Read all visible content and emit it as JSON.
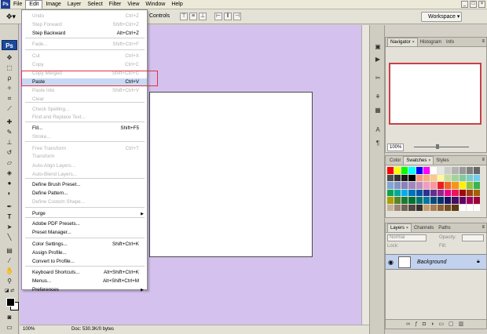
{
  "menubar": {
    "items": [
      "File",
      "Edit",
      "Image",
      "Layer",
      "Select",
      "Filter",
      "View",
      "Window",
      "Help"
    ],
    "active_index": 1
  },
  "options_bar": {
    "controls_label": "Controls",
    "workspace_label": "Workspace ▾"
  },
  "tools": {
    "ps_logo": "Ps"
  },
  "edit_menu": {
    "items": [
      {
        "label": "Undo",
        "shortcut": "Ctrl+Z",
        "enabled": false
      },
      {
        "label": "Step Forward",
        "shortcut": "Shift+Ctrl+Z",
        "enabled": false
      },
      {
        "label": "Step Backward",
        "shortcut": "Alt+Ctrl+Z",
        "enabled": true
      },
      {
        "label": "Fade...",
        "shortcut": "Shift+Ctrl+F",
        "enabled": false
      },
      {
        "label": "Cut",
        "shortcut": "Ctrl+X",
        "enabled": false
      },
      {
        "label": "Copy",
        "shortcut": "Ctrl+C",
        "enabled": false
      },
      {
        "label": "Copy Merged",
        "shortcut": "Shift+Ctrl+C",
        "enabled": false
      },
      {
        "label": "Paste",
        "shortcut": "Ctrl+V",
        "enabled": true,
        "highlighted": true
      },
      {
        "label": "Paste Into",
        "shortcut": "Shift+Ctrl+V",
        "enabled": false
      },
      {
        "label": "Clear",
        "shortcut": "",
        "enabled": false
      },
      {
        "label": "Check Spelling...",
        "shortcut": "",
        "enabled": false
      },
      {
        "label": "Find and Replace Text...",
        "shortcut": "",
        "enabled": false
      },
      {
        "label": "Fill...",
        "shortcut": "Shift+F5",
        "enabled": true
      },
      {
        "label": "Stroke...",
        "shortcut": "",
        "enabled": false
      },
      {
        "label": "Free Transform",
        "shortcut": "Ctrl+T",
        "enabled": false
      },
      {
        "label": "Transform",
        "shortcut": "",
        "enabled": false
      },
      {
        "label": "Auto-Align Layers...",
        "shortcut": "",
        "enabled": false
      },
      {
        "label": "Auto-Blend Layers...",
        "shortcut": "",
        "enabled": false
      },
      {
        "label": "Define Brush Preset...",
        "shortcut": "",
        "enabled": true
      },
      {
        "label": "Define Pattern...",
        "shortcut": "",
        "enabled": true
      },
      {
        "label": "Define Custom Shape...",
        "shortcut": "",
        "enabled": false
      },
      {
        "label": "Purge",
        "shortcut": "",
        "enabled": true,
        "submenu": true
      },
      {
        "label": "Adobe PDF Presets...",
        "shortcut": "",
        "enabled": true
      },
      {
        "label": "Preset Manager...",
        "shortcut": "",
        "enabled": true
      },
      {
        "label": "Color Settings...",
        "shortcut": "Shift+Ctrl+K",
        "enabled": true
      },
      {
        "label": "Assign Profile...",
        "shortcut": "",
        "enabled": true
      },
      {
        "label": "Convert to Profile...",
        "shortcut": "",
        "enabled": true
      },
      {
        "label": "Keyboard Shortcuts...",
        "shortcut": "Alt+Shift+Ctrl+K",
        "enabled": true
      },
      {
        "label": "Menus...",
        "shortcut": "Alt+Shift+Ctrl+M",
        "enabled": true
      },
      {
        "label": "Preferences",
        "shortcut": "",
        "enabled": true,
        "submenu": true
      }
    ]
  },
  "navigator": {
    "tabs": [
      "Navigator",
      "Histogram",
      "Info"
    ],
    "zoom": "100%"
  },
  "swatches": {
    "tabs": [
      "Color",
      "Swatches",
      "Styles"
    ]
  },
  "layers": {
    "tabs": [
      "Layers",
      "Channels",
      "Paths"
    ],
    "blend_mode": "Normal",
    "opacity_label": "Opacity:",
    "lock_label": "Lock:",
    "fill_label": "Fill:",
    "layer_name": "Background"
  },
  "status": {
    "zoom": "100%",
    "doc": "Doc: 530.3K/0 bytes"
  },
  "colors": {
    "canvas_bg": "#d5c1ee",
    "highlight": "#e0323c",
    "menu_highlight": "#c8d9f3"
  }
}
